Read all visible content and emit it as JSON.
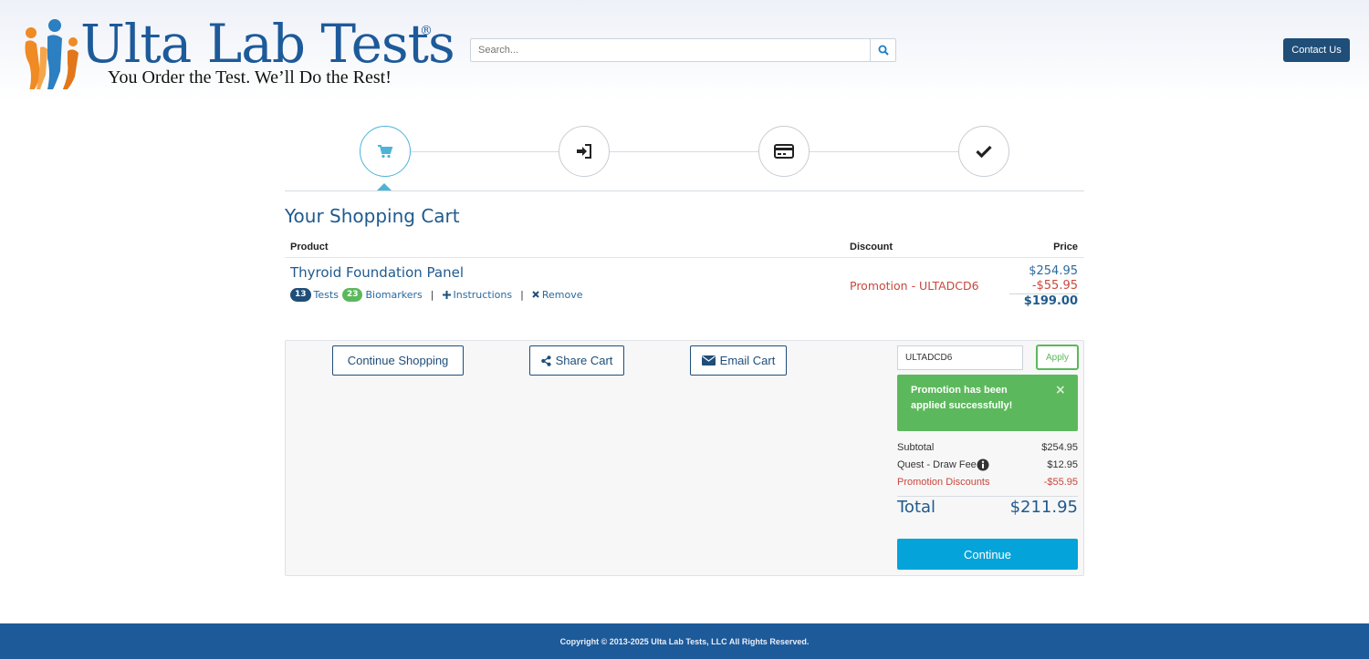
{
  "brand": {
    "name": "Ulta Lab Tests",
    "registered": "®",
    "tagline": "You Order the Test. We’ll Do the Rest!"
  },
  "search": {
    "placeholder": "Search..."
  },
  "header": {
    "contact_label": "Contact Us"
  },
  "steps": [
    {
      "icon": "cart-icon",
      "active": true
    },
    {
      "icon": "sign-in-icon",
      "active": false
    },
    {
      "icon": "credit-card-icon",
      "active": false
    },
    {
      "icon": "check-icon",
      "active": false
    }
  ],
  "cart": {
    "title": "Your Shopping Cart",
    "columns": {
      "product": "Product",
      "discount": "Discount",
      "price": "Price"
    },
    "item": {
      "name": "Thyroid Foundation Panel",
      "tests_count": "13",
      "tests_label": "Tests",
      "biomarkers_count": "23",
      "biomarkers_label": "Biomarkers",
      "separator": "|",
      "instructions_label": "Instructions",
      "remove_label": "Remove",
      "discount_label": "Promotion - ULTADCD6",
      "price_original": "$254.95",
      "price_discount": "-$55.95",
      "price_final": "$199.00"
    }
  },
  "actions": {
    "continue_shopping": "Continue Shopping",
    "share_cart": "Share Cart",
    "email_cart": "Email Cart"
  },
  "promo": {
    "code_value": "ULTADCD6",
    "apply_label": "Apply",
    "success_message": "Promotion has been applied successfully!",
    "close_glyph": "×"
  },
  "summary": {
    "subtotal_label": "Subtotal",
    "subtotal_value": "$254.95",
    "draw_fee_label": "Quest - Draw Fee",
    "draw_fee_value": "$12.95",
    "promo_label": "Promotion Discounts",
    "promo_value": "-$55.95",
    "total_label": "Total",
    "total_value": "$211.95",
    "continue_label": "Continue"
  },
  "footer": {
    "copyright": "Copyright © 2013-2025 Ulta Lab Tests, LLC All Rights Reserved."
  },
  "colors": {
    "brand_blue": "#1d5a9a",
    "navy": "#1f4e79",
    "accent_cyan": "#04a3d9",
    "success_green": "#5cb85c",
    "promo_red": "#c9473d",
    "logo_orange": "#f08a24"
  }
}
